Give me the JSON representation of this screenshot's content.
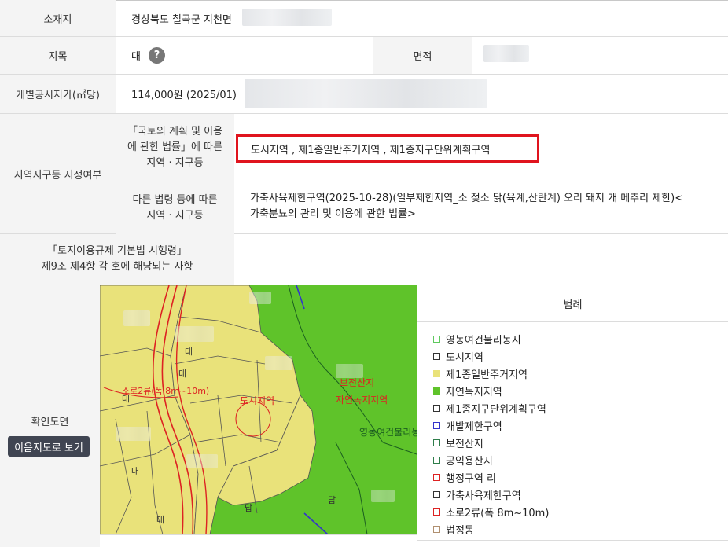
{
  "rows": {
    "location": {
      "label": "소재지",
      "value": "경상북도 칠곡군 지천면"
    },
    "land_category": {
      "label": "지목",
      "value": "대",
      "help_icon": "question-icon",
      "help_glyph": "?"
    },
    "area": {
      "label": "면적"
    },
    "price": {
      "label": "개별공시지가(㎡당)",
      "value": "114,000원 (2025/01)"
    },
    "zoning": {
      "label": "지역지구등 지정여부",
      "sub1_label_l1": "「국토의 계획 및 이용",
      "sub1_label_l2": "에 관한 법률」에 따른",
      "sub1_label_l3": "지역 · 지구등",
      "sub1_value": "도시지역 , 제1종일반주거지역 , 제1종지구단위계획구역",
      "sub2_label_l1": "다른 법령 등에 따른",
      "sub2_label_l2": "지역 · 지구등",
      "sub2_value_l1": "가축사육제한구역(2025-10-28)(일부제한지역_소 젖소 닭(육계,산란계) 오리 돼지 개 메추리 제한)<",
      "sub2_value_l2": "가축분뇨의 관리 및 이용에 관한 법률>"
    },
    "regulation": {
      "label_l1": "「토지이용규제 기본법 시행령」",
      "label_l2": "제9조 제4항 각 호에 해당되는 사항"
    }
  },
  "map_section": {
    "label": "확인도면",
    "button": "이음지도로 보기",
    "map_labels": {
      "road": "소로2류(폭 8m~10m)",
      "urban": "도시지역",
      "conservation1": "보전산지",
      "conservation2": "자연녹지지역",
      "farmland": "영농여건불리농",
      "plot1": "대",
      "plot2": "대",
      "plot3": "대",
      "plot4": "답",
      "plot5": "답",
      "plot6": "대",
      "plot7": "대"
    }
  },
  "legend": {
    "title": "범례",
    "items": [
      {
        "label": "영농여건불리농지",
        "color": "#5ec95e",
        "fill": "#ffffff"
      },
      {
        "label": "도시지역",
        "color": "#333333",
        "fill": "#ffffff"
      },
      {
        "label": "제1종일반주거지역",
        "color": "#e9e27a",
        "fill": "#e9e27a"
      },
      {
        "label": "자연녹지지역",
        "color": "#5fc32a",
        "fill": "#5fc32a"
      },
      {
        "label": "제1종지구단위계획구역",
        "color": "#333333",
        "fill": "#ffffff"
      },
      {
        "label": "개발제한구역",
        "color": "#3333cc",
        "fill": "#ffffff"
      },
      {
        "label": "보전산지",
        "color": "#2e7d4a",
        "fill": "#ffffff"
      },
      {
        "label": "공익용산지",
        "color": "#2e7d4a",
        "fill": "#ffffff"
      },
      {
        "label": "행정구역 리",
        "color": "#dd2222",
        "fill": "#ffffff"
      },
      {
        "label": "가축사육제한구역",
        "color": "#333333",
        "fill": "#ffffff"
      },
      {
        "label": "소로2류(폭 8m~10m)",
        "color": "#dd2222",
        "fill": "#ffffff"
      },
      {
        "label": "법정동",
        "color": "#b09070",
        "fill": "#ffffff"
      }
    ]
  },
  "colors": {
    "highlight": "#e0141e",
    "header_bg": "#f4f4f4",
    "map_green": "#5fc32a",
    "map_yellow": "#e9e27a"
  }
}
